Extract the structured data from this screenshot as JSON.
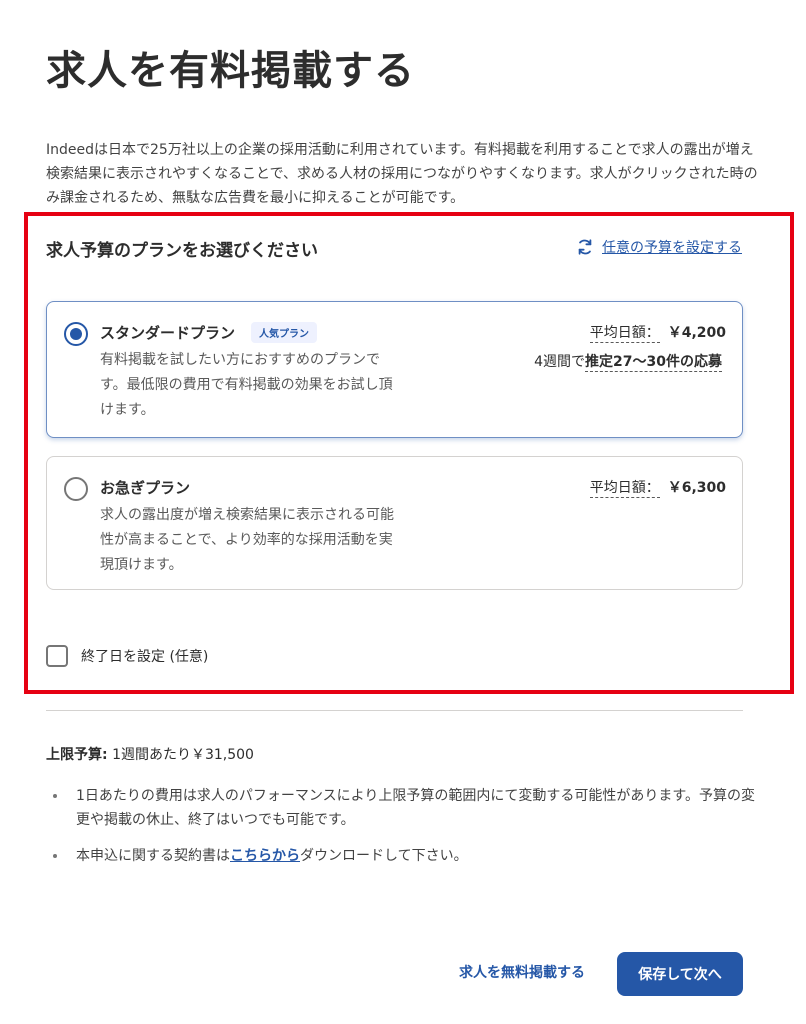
{
  "page": {
    "title": "求人を有料掲載する",
    "intro": "Indeedは日本で25万社以上の企業の採用活動に利用されています。有料掲載を利用することで求人の露出が増え検索結果に表示されやすくなることで、求める人材の採用につながりやすくなります。求人がクリックされた時のみ課金されるため、無駄な広告費を最小に抑えることが可能です。"
  },
  "plan_section": {
    "title": "求人予算のプランをお選びください",
    "custom_budget_link": "任意の予算を設定する",
    "custom_budget_icon": "refresh-icon",
    "highlight_color": "#e60012"
  },
  "plans": [
    {
      "name": "スタンダードプラン",
      "badge": "人気プラン",
      "selected": true,
      "description": "有料掲載を試したい方におすすめのプランです。最低限の費用で有料掲載の効果をお試し頂けます。",
      "avg_label": "平均日額：",
      "price": "￥4,200",
      "estimate_prefix": "4週間で",
      "estimate_value": "推定27～30件の応募"
    },
    {
      "name": "お急ぎプラン",
      "selected": false,
      "description": "求人の露出度が増え検索結果に表示される可能性が高まることで、より効率的な採用活動を実現頂けます。",
      "avg_label": "平均日額：",
      "price": "￥6,300"
    }
  ],
  "end_date": {
    "label": "終了日を設定 (任意)",
    "checked": false
  },
  "budget_cap": {
    "label": "上限予算:",
    "value": "1週間あたり￥31,500"
  },
  "notes": {
    "note1": "1日あたりの費用は求人のパフォーマンスにより上限予算の範囲内にて変動する可能性があります。予算の変更や掲載の休止、終了はいつでも可能です。",
    "note2_prefix": "本申込に関する契約書は",
    "note2_link": "こちらから",
    "note2_suffix": "ダウンロードして下さい。"
  },
  "actions": {
    "free_post": "求人を無料掲載する",
    "save_next": "保存して次へ"
  },
  "colors": {
    "accent": "#2557a7",
    "text": "#2d2d2d"
  }
}
